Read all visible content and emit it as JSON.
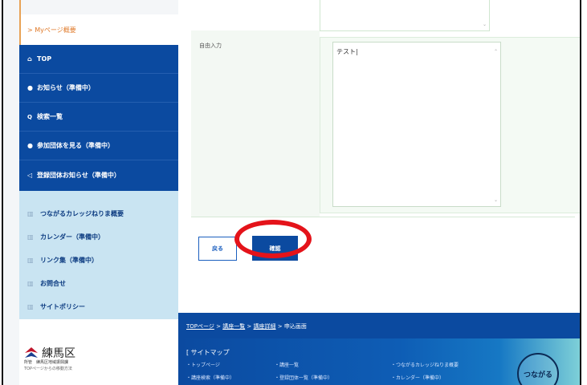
{
  "sidebar": {
    "current_label": "> Myページ概要",
    "blue_items": [
      {
        "icon": "home-icon",
        "glyph": "⌂",
        "label": "TOP"
      },
      {
        "icon": "info-icon",
        "glyph": "●",
        "label": "お知らせ（準備中）"
      },
      {
        "icon": "search-icon",
        "glyph": "🔍",
        "label": "検索一覧"
      },
      {
        "icon": "bullet-icon",
        "glyph": "●",
        "label": "参加団体を見る（準備中）"
      },
      {
        "icon": "megaphone-icon",
        "glyph": "◁",
        "label": "登録団体お知らせ（準備中）"
      }
    ],
    "light_items": [
      {
        "label": "つながるカレッジねりま概要"
      },
      {
        "label": "カレンダー（準備中）"
      },
      {
        "label": "リンク集（準備中）"
      },
      {
        "label": "お問合せ"
      },
      {
        "label": "サイトポリシー"
      }
    ],
    "brand": {
      "name": "練馬区",
      "sub1": "所管　練馬区地域振興課",
      "sub2": "TOPページからの移動方法"
    }
  },
  "form": {
    "field_label": "自由入力",
    "textarea_value": "テスト|"
  },
  "buttons": {
    "back": "戻る",
    "confirm": "確認"
  },
  "footer": {
    "breadcrumb": [
      "TOPページ",
      "講座一覧",
      "講座詳細",
      "申込画面"
    ],
    "sitemap_title": "[ サイトマップ",
    "links": [
      "・トップページ",
      "・講座一覧",
      "・つながるカレッジねりま概要",
      "・講座検索（準備中）",
      "・登録団体一覧（準備中）",
      "・カレンダー（準備中）"
    ],
    "badge_text": "つながる"
  },
  "colors": {
    "primary": "#0b4aa0",
    "accent_orange": "#e8a255",
    "highlight_red": "#e4131a",
    "sidebar_light": "#c9e4f2"
  }
}
